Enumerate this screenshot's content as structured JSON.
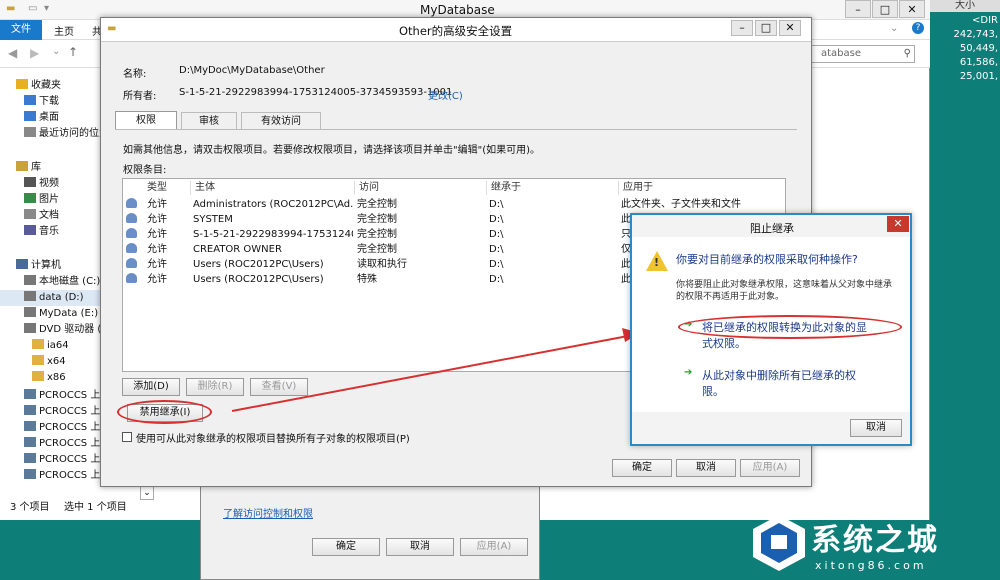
{
  "explorer": {
    "title": "MyDatabase",
    "ribbon_tabs": [
      "文件",
      "主页",
      "共享"
    ],
    "search_text": "atabase",
    "tree": [
      {
        "label": "收藏夹",
        "icon": "star-icon"
      },
      {
        "label": "下载",
        "icon": "download-icon"
      },
      {
        "label": "桌面",
        "icon": "desktop-icon"
      },
      {
        "label": "最近访问的位置",
        "icon": "recent-icon"
      },
      {
        "label": "库",
        "icon": "library-icon"
      },
      {
        "label": "视频",
        "icon": "video-icon"
      },
      {
        "label": "图片",
        "icon": "picture-icon"
      },
      {
        "label": "文档",
        "icon": "document-icon"
      },
      {
        "label": "音乐",
        "icon": "music-icon"
      },
      {
        "label": "计算机",
        "icon": "computer-icon"
      },
      {
        "label": "本地磁盘 (C:)",
        "icon": "drive-icon"
      },
      {
        "label": "data (D:)",
        "icon": "drive-icon"
      },
      {
        "label": "MyData (E:)",
        "icon": "drive-icon"
      },
      {
        "label": "DVD 驱动器 (",
        "icon": "dvd-icon"
      },
      {
        "label": "ia64",
        "icon": "folder-icon"
      },
      {
        "label": "x64",
        "icon": "folder-icon"
      },
      {
        "label": "x86",
        "icon": "folder-icon"
      },
      {
        "label": "PCROCCS 上的",
        "icon": "network-drive-icon"
      },
      {
        "label": "PCROCCS 上的",
        "icon": "network-drive-icon"
      },
      {
        "label": "PCROCCS 上的",
        "icon": "network-drive-icon"
      },
      {
        "label": "PCROCCS 上的",
        "icon": "network-drive-icon"
      },
      {
        "label": "PCROCCS 上的",
        "icon": "network-drive-icon"
      },
      {
        "label": "PCROCCS 上的",
        "icon": "network-drive-icon"
      }
    ],
    "status_count": "3 个项目",
    "status_selected": "选中 1 个项目"
  },
  "right_list": {
    "header": "大小",
    "items": [
      "<DIR",
      "242,743,",
      "50,449,",
      "61,586,",
      "25,001,"
    ]
  },
  "props": {
    "link": "了解访问控制和权限",
    "ok": "确定",
    "cancel": "取消",
    "apply": "应用(A)"
  },
  "adv": {
    "title": "Other的高级安全设置",
    "name_label": "名称:",
    "name_value": "D:\\MyDoc\\MyDatabase\\Other",
    "owner_label": "所有者:",
    "owner_value": "S-1-5-21-2922983994-1753124005-3734593593-1001",
    "change_link": "更改(C)",
    "tabs": [
      "权限",
      "审核",
      "有效访问"
    ],
    "info_text": "如需其他信息，请双击权限项目。若要修改权限项目，请选择该项目并单击\"编辑\"(如果可用)。",
    "entries_label": "权限条目:",
    "columns": [
      "类型",
      "主体",
      "访问",
      "继承于",
      "应用于"
    ],
    "rows": [
      {
        "type": "允许",
        "principal": "Administrators (ROC2012PC\\Ad...",
        "access": "完全控制",
        "inherited": "D:\\",
        "applies": "此文件夹、子文件夹和文件"
      },
      {
        "type": "允许",
        "principal": "SYSTEM",
        "access": "完全控制",
        "inherited": "D:\\",
        "applies": "此文件夹、子文件夹和文件"
      },
      {
        "type": "允许",
        "principal": "S-1-5-21-2922983994-17531240...",
        "access": "完全控制",
        "inherited": "D:\\",
        "applies": "只"
      },
      {
        "type": "允许",
        "principal": "CREATOR OWNER",
        "access": "完全控制",
        "inherited": "D:\\",
        "applies": "仅"
      },
      {
        "type": "允许",
        "principal": "Users (ROC2012PC\\Users)",
        "access": "读取和执行",
        "inherited": "D:\\",
        "applies": "此"
      },
      {
        "type": "允许",
        "principal": "Users (ROC2012PC\\Users)",
        "access": "特殊",
        "inherited": "D:\\",
        "applies": "此"
      }
    ],
    "add": "添加(D)",
    "remove": "删除(R)",
    "view": "查看(V)",
    "disable_inherit": "禁用继承(I)",
    "replace_label": "使用可从此对象继承的权限项目替换所有子对象的权限项目(P)",
    "ok": "确定",
    "cancel": "取消",
    "apply": "应用(A)"
  },
  "block": {
    "title": "阻止继承",
    "question": "你要对目前继承的权限采取何种操作?",
    "desc1": "你将要阻止此对象继承权限，这意味着从父对象中继承",
    "desc2": "的权限不再适用于此对象。",
    "option1_line1": "将已继承的权限转换为此对象的显",
    "option1_line2": "式权限。",
    "option2_line1": "从此对象中删除所有已继承的权",
    "option2_line2": "限。",
    "cancel": "取消"
  },
  "logo": {
    "name": "系统之城",
    "url": "xitong86.com"
  },
  "colors": {
    "accent_blue": "#1979ca",
    "annotation_red": "#d63030",
    "background_teal": "#0e7e78"
  }
}
